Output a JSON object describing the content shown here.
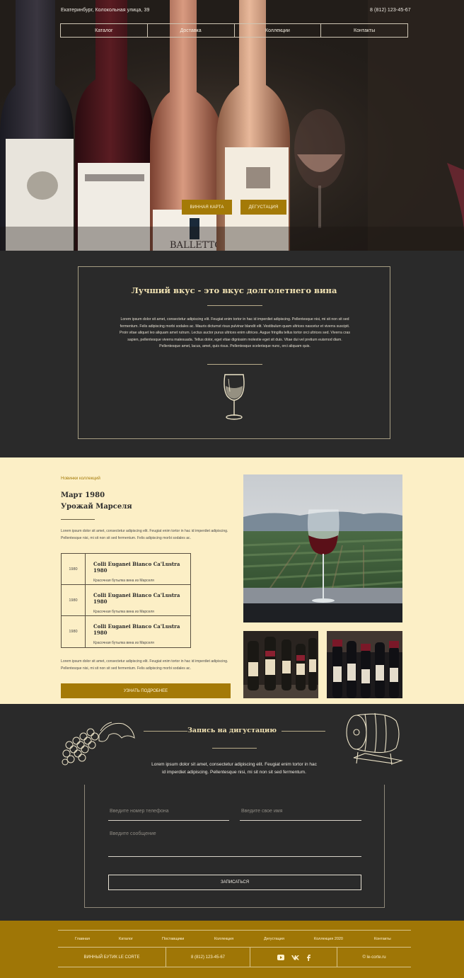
{
  "header": {
    "address": "Екатеринбург, Колокольная улица, 39",
    "phone": "8 (812) 123-45-67"
  },
  "nav": [
    "Каталог",
    "Доставка",
    "Коллекции",
    "Контакты"
  ],
  "hero": {
    "btn_wine_card": "ВИННАЯ КАРТА",
    "btn_tasting": "ДЕГУСТАЦИЯ",
    "bottle_label_text": "BALLETTO"
  },
  "intro": {
    "title": "Лучший вкус - это вкус долголетнего вина",
    "text": "Lorem ipsum dolor sit amet, consectetur adipiscing elit. Feugiat enim tortor in hac id imperdiet adipiscing. Pellentesque nisi, mi sit non sit sed fermentum. Felis adipiscing morbi sodales ac. Mauris dictumst risus pulvinar blandit elit. Vestibulum quam ultrices nascetur et viverra suscipit. Proin vitae aliquet leo aliquam amet rutrum. Lectus auctor purus ultrices enim ultrices. Augue fringilla tellus tortor orci ultrices sed. Viverra cras sapien, pellentesque viverra malesuada. Tellus dolor, eget vitae dignissim molestie eget sit duis. Vitae dui vel pretium euismod diam. Pellentesque amet, lacus, amet, quis risus. Pellentesque scelerisque nunc, orci aliquam quis."
  },
  "collection": {
    "kicker": "Новинки коллекций",
    "title_line1": "Март 1980",
    "title_line2": "Урожай Марселя",
    "text_top": "Lorem ipsum dolor sit amet, consectetur adipiscing elit. Feugiat enim tortor in hac id imperdiet adipiscing. Pellentesque nisi, mi sit non sit sed fermentum. Felis adipiscing morbi sodales ac.",
    "items": [
      {
        "year": "1980",
        "name": "Colli Euganei Bianco Ca'Lustra 1980",
        "desc": "Красочная бутылка вина из Марселя"
      },
      {
        "year": "1980",
        "name": "Colli Euganei Bianco Ca'Lustra 1980",
        "desc": "Красочная бутылка вина из Марселя"
      },
      {
        "year": "1980",
        "name": "Colli Euganei Bianco Ca'Lustra 1980",
        "desc": "Красочная бутылка вина из Марселя"
      }
    ],
    "text_bottom": "Lorem ipsum dolor sit amet, consectetur adipiscing elit. Feugiat enim tortor in hac id imperdiet adipiscing. Pellentesque nisi, mi sit non sit sed fermentum. Felis adipiscing morbi sodales ac.",
    "more_button": "УЗНАТЬ ПОДРОБНЕЕ"
  },
  "tasting": {
    "title": "Запись на дигустацию",
    "text": "Lorem ipsum dolor sit amet, consectetur adipiscing elit. Feugiat enim tortor in hac id imperdiet adipiscing. Pellentesque nisi, mi sit non sit sed fermentum.",
    "phone_placeholder": "Введите номер телефона",
    "name_placeholder": "Введите свое имя",
    "message_placeholder": "Введите сообщение",
    "submit": "ЗАПИСАТЬСЯ"
  },
  "footer": {
    "links": [
      "Главная",
      "Каталог",
      "Поставщики",
      "Коллекция",
      "Дегустация",
      "Коллекция 2020",
      "Контакты"
    ],
    "brand": "ВИННЫЙ БУТИК LE CORTE",
    "phone": "8 (812) 123-45-67",
    "socials": [
      "youtube-icon",
      "vk-icon",
      "facebook-icon"
    ],
    "site": "© le-corte.ru"
  },
  "colors": {
    "accent": "#a47a07",
    "dark": "#2a2a2a",
    "cream": "#fcefc6",
    "heading": "#f3e4b4"
  }
}
